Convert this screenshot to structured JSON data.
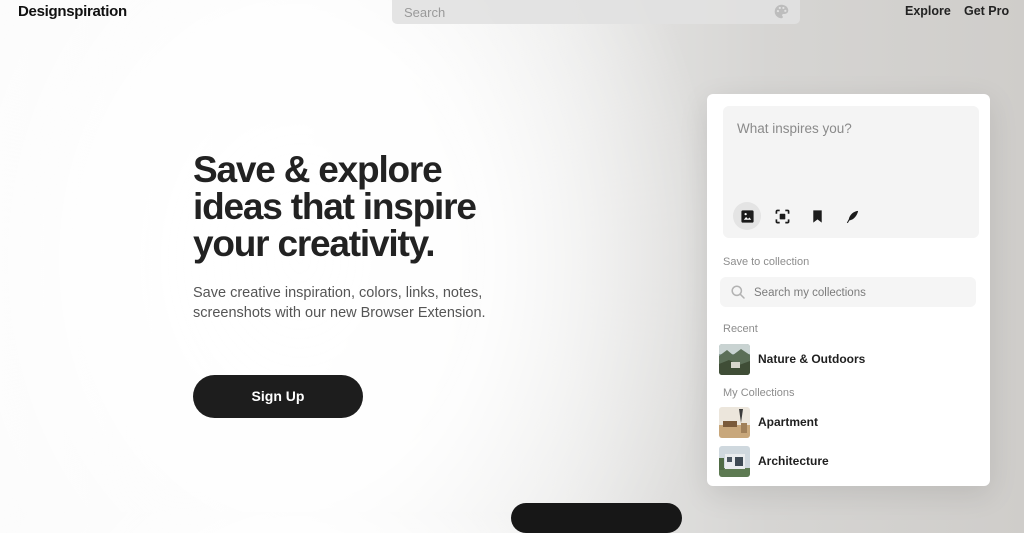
{
  "header": {
    "logo": "Designspiration",
    "search_placeholder": "Search",
    "palette_icon": "palette-icon",
    "nav": {
      "explore": "Explore",
      "get_pro": "Get Pro"
    }
  },
  "hero": {
    "title_line1": "Save & explore",
    "title_line2": "ideas that inspire",
    "title_line3": "your creativity.",
    "subtitle_line1": "Save creative inspiration, colors, links, notes,",
    "subtitle_line2": "screenshots with our new Browser Extension.",
    "signup_label": "Sign Up"
  },
  "panel": {
    "compose_placeholder": "What inspires you?",
    "tools": [
      "image-icon",
      "screenshot-icon",
      "bookmark-icon",
      "feather-icon"
    ],
    "save_to_collection_label": "Save to collection",
    "collection_search_placeholder": "Search my collections",
    "recent_label": "Recent",
    "recent_items": [
      {
        "label": "Nature & Outdoors"
      }
    ],
    "my_collections_label": "My Collections",
    "collections": [
      {
        "label": "Apartment"
      },
      {
        "label": "Architecture"
      }
    ]
  },
  "colors": {
    "button": "#1d1d1d",
    "panel_bg": "#ffffff",
    "accent_text": "#222222"
  }
}
